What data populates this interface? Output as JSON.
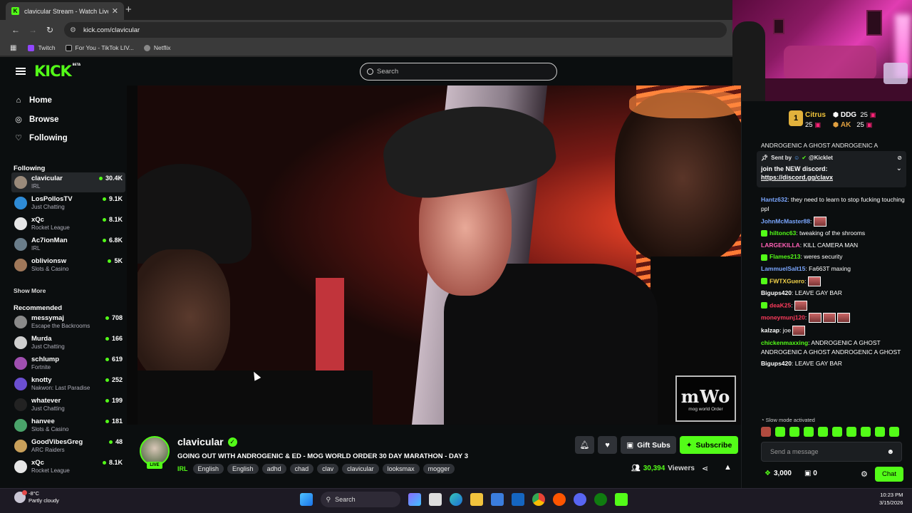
{
  "browser": {
    "tab_title": "clavicular Stream - Watch Live o",
    "url": "kick.com/clavicular",
    "bookmarks": [
      {
        "label": "Twitch",
        "icon": "twitch-icon",
        "color": "#9146ff"
      },
      {
        "label": "For You - TikTok LIV...",
        "icon": "tiktok-icon",
        "color": "#111111"
      },
      {
        "label": "Netflix",
        "icon": "globe-icon",
        "color": "#888888"
      }
    ]
  },
  "header": {
    "logo": "KICK",
    "logo_badge": "BETA",
    "search_placeholder": "Search"
  },
  "sidebar": {
    "nav": [
      {
        "label": "Home",
        "icon": "home-icon",
        "glyph": "⌂"
      },
      {
        "label": "Browse",
        "icon": "compass-icon",
        "glyph": "◎"
      },
      {
        "label": "Following",
        "icon": "heart-icon",
        "glyph": "♡"
      }
    ],
    "following_heading": "Following",
    "following": [
      {
        "name": "clavicular",
        "category": "IRL",
        "viewers": "30.4K",
        "color": "#9a8a7a"
      },
      {
        "name": "LosPollosTV",
        "category": "Just Chatting",
        "viewers": "9.1K",
        "color": "#2e8bd6"
      },
      {
        "name": "xQc",
        "category": "Rocket League",
        "viewers": "8.1K",
        "color": "#e6e6e6"
      },
      {
        "name": "Ac7ionMan",
        "category": "IRL",
        "viewers": "6.8K",
        "color": "#6a7d8a"
      },
      {
        "name": "oblivionsw",
        "category": "Slots & Casino",
        "viewers": "5K",
        "color": "#a0785a"
      }
    ],
    "show_more": "Show More",
    "recommended_heading": "Recommended",
    "recommended": [
      {
        "name": "messymaj",
        "category": "Escape the Backrooms",
        "viewers": "708",
        "color": "#8a8a8a"
      },
      {
        "name": "Murda",
        "category": "Just Chatting",
        "viewers": "166",
        "color": "#cfcfcf"
      },
      {
        "name": "schlump",
        "category": "Fortnite",
        "viewers": "619",
        "color": "#a04fb0"
      },
      {
        "name": "knotty",
        "category": "Nakwon: Last Paradise",
        "viewers": "252",
        "color": "#6b4fd1"
      },
      {
        "name": "whatever",
        "category": "Just Chatting",
        "viewers": "199",
        "color": "#222222"
      },
      {
        "name": "hanvee",
        "category": "Slots & Casino",
        "viewers": "181",
        "color": "#4aa36a"
      },
      {
        "name": "GoodVibesGreg",
        "category": "ARC Raiders",
        "viewers": "48",
        "color": "#c9a05a"
      },
      {
        "name": "xQc",
        "category": "Rocket League",
        "viewers": "8.1K",
        "color": "#e6e6e6"
      }
    ]
  },
  "video": {
    "watermark_big": "mWo",
    "watermark_small": "mog world Order"
  },
  "stream": {
    "channel": "clavicular",
    "live_label": "LIVE",
    "title": "GOING OUT WITH ANDROGENIC & ED - MOG WORLD ORDER 30 DAY MARATHON - DAY 3",
    "category": "IRL",
    "tags": [
      "English",
      "English",
      "adhd",
      "chad",
      "clav",
      "clavicular",
      "looksmax",
      "mogger"
    ],
    "gift_label": "Gift Subs",
    "subscribe_label": "Subscribe",
    "viewers": "30,394",
    "viewers_label": "Viewers"
  },
  "chat": {
    "leaderboard": [
      {
        "name": "Citrus",
        "count": "25"
      },
      {
        "name": "DDG",
        "count": "25"
      },
      {
        "name": "AK",
        "count": "25"
      }
    ],
    "leader_rank": "1",
    "truncated_top": "ANDROGENIC A GHOST  ANDROGENIC A",
    "pinned": {
      "sent_by": "Sent by",
      "sender": "@Kicklet",
      "message": "join the NEW discord:",
      "link": "https://discord.gg/clavx"
    },
    "messages": [
      {
        "user": "Hantz632",
        "color": "#7ba7ff",
        "text": ": they need to learn to stop fucking touching ppl"
      },
      {
        "user": "JohnMcMaster88",
        "color": "#7ba7ff",
        "text": ":",
        "emotes": 1
      },
      {
        "user": "hiltonc63",
        "color": "#53fc18",
        "text": ": tweaking of the shrooms",
        "badge": true
      },
      {
        "user": "LARGEKILLA",
        "color": "#ff5fb5",
        "text": ": KILL CAMERA MAN"
      },
      {
        "user": "Flames213",
        "color": "#53fc18",
        "text": ": weres security",
        "badge": true
      },
      {
        "user": "LammuelSalt15",
        "color": "#7ba7ff",
        "text": ": Fa663T maxing"
      },
      {
        "user": "FWTXGuero",
        "color": "#f3d34a",
        "text": ":",
        "emotes": 1,
        "badge": true
      },
      {
        "user": "Bigups420",
        "color": "#ffffff",
        "text": ": LEAVE GAY BAR"
      },
      {
        "user": "deaK25",
        "color": "#ff3b5c",
        "text": ":",
        "emotes": 1,
        "badge": true
      },
      {
        "user": "moneymunj120",
        "color": "#ff3b5c",
        "text": ":",
        "emotes": 3
      },
      {
        "user": "kalzap",
        "color": "#ffffff",
        "text": ": joe",
        "emotes": 1
      },
      {
        "user": "chickenmaxxing",
        "color": "#53fc18",
        "text": ": ANDROGENIC A GHOST  ANDROGENIC A GHOST  ANDROGENIC A GHOST"
      },
      {
        "user": "Bigups420",
        "color": "#ffffff",
        "text": ": LEAVE GAY BAR"
      }
    ],
    "slow_mode": "Slow mode activated",
    "input_placeholder": "Send a message",
    "points": "3,000",
    "gifts": "0",
    "chat_button": "Chat"
  },
  "taskbar": {
    "temp": "-8°C",
    "weather": "Partly cloudy",
    "search": "Search",
    "time": "10:23 PM",
    "date": "3/15/2026"
  }
}
